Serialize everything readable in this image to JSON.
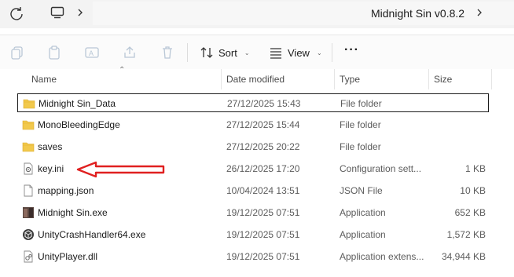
{
  "addressbar": {
    "breadcrumb": "Midnight Sin v0.8.2"
  },
  "toolbar": {
    "sort_label": "Sort",
    "view_label": "View",
    "more_label": "···"
  },
  "columns": {
    "name": "Name",
    "date": "Date modified",
    "type": "Type",
    "size": "Size"
  },
  "files": [
    {
      "name": "Midnight Sin_Data",
      "date": "27/12/2025 15:43",
      "type": "File folder",
      "size": "",
      "icon": "folder-icon"
    },
    {
      "name": "MonoBleedingEdge",
      "date": "27/12/2025 15:44",
      "type": "File folder",
      "size": "",
      "icon": "folder-icon"
    },
    {
      "name": "saves",
      "date": "27/12/2025 20:22",
      "type": "File folder",
      "size": "",
      "icon": "folder-icon"
    },
    {
      "name": "key.ini",
      "date": "26/12/2025 17:20",
      "type": "Configuration sett...",
      "size": "1 KB",
      "icon": "config-file-icon"
    },
    {
      "name": "mapping.json",
      "date": "10/04/2024 13:51",
      "type": "JSON File",
      "size": "10 KB",
      "icon": "document-icon"
    },
    {
      "name": "Midnight Sin.exe",
      "date": "19/12/2025 07:51",
      "type": "Application",
      "size": "652 KB",
      "icon": "app-icon"
    },
    {
      "name": "UnityCrashHandler64.exe",
      "date": "19/12/2025 07:51",
      "type": "Application",
      "size": "1,572 KB",
      "icon": "unity-icon"
    },
    {
      "name": "UnityPlayer.dll",
      "date": "19/12/2025 07:51",
      "type": "Application extens...",
      "size": "34,944 KB",
      "icon": "dll-icon"
    }
  ],
  "colors": {
    "folder": "#f2c94c",
    "arrow": "#e02020",
    "selection_border": "#1b1b1b"
  }
}
